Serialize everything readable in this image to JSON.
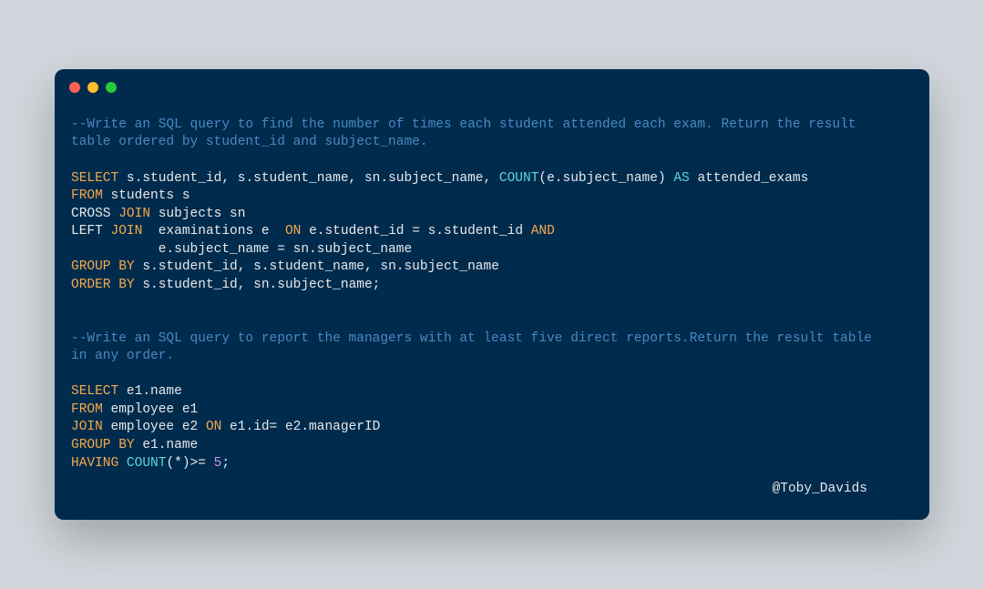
{
  "window": {
    "dots": {
      "close": "#ff5f57",
      "min": "#febc2e",
      "max": "#28c840"
    }
  },
  "code": {
    "c1a": "--Write an SQL query to find the number of times each student attended each exam. Return the result ",
    "c1b": "table ordered by student_id and subject_name.",
    "q1": {
      "l1": {
        "kw_select": "SELECT",
        "cols_pre": " s.student_id, s.student_name, sn.subject_name, ",
        "fn_count": "COUNT",
        "lp": "(",
        "arg": "e.subject_name",
        "rp": ") ",
        "as": "AS",
        "alias": " attended_exams"
      },
      "l2": {
        "kw_from": "FROM",
        "rest": " students s"
      },
      "l3": {
        "pre": "CROSS ",
        "kw_join": "JOIN",
        "rest": " subjects sn"
      },
      "l4": {
        "pre": "LEFT ",
        "kw_join": "JOIN",
        "mid": "  examinations e  ",
        "kw_on": "ON",
        "cond": " e.student_id = s.student_id ",
        "kw_and": "AND"
      },
      "l5": {
        "rest": "           e.subject_name = sn.subject_name"
      },
      "l6": {
        "kw": "GROUP BY",
        "rest": " s.student_id, s.student_name, sn.subject_name"
      },
      "l7": {
        "kw": "ORDER BY",
        "rest": " s.student_id, sn.subject_name;"
      }
    },
    "c2a": "--Write an SQL query to report the managers with at least five direct reports.Return the result table ",
    "c2b": "in any order.",
    "q2": {
      "l1": {
        "kw_select": "SELECT",
        "rest": " e1.name"
      },
      "l2": {
        "kw_from": "FROM",
        "rest": " employee e1"
      },
      "l3": {
        "kw_join": "JOIN",
        "mid": " employee e2 ",
        "kw_on": "ON",
        "rest": " e1.id= e2.managerID"
      },
      "l4": {
        "kw": "GROUP BY",
        "rest": " e1.name"
      },
      "l5": {
        "kw_having": "HAVING",
        "sp": " ",
        "fn_count": "COUNT",
        "lp": "(",
        "star": "*",
        "rp": ")",
        "gte": ">= ",
        "num": "5",
        "semi": ";"
      }
    }
  },
  "credit": "@Toby_Davids"
}
